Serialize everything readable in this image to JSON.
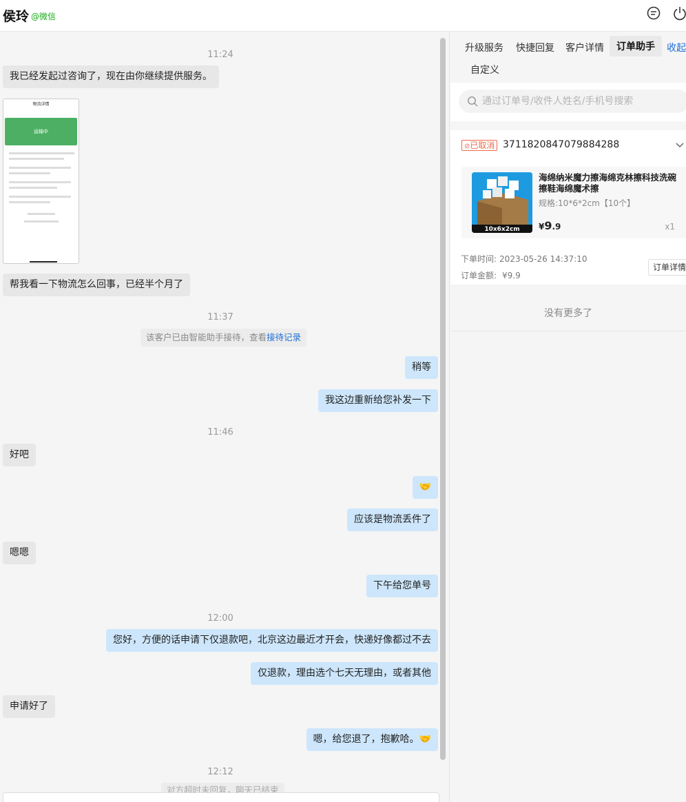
{
  "header": {
    "contact_name": "侯玲",
    "contact_source": "@微信",
    "icons": [
      "chat-bubble-icon",
      "power-icon"
    ]
  },
  "chat": {
    "messages": [
      {
        "type": "time",
        "text": "11:24"
      },
      {
        "type": "left",
        "text": "我已经发起过咨询了，现在由你继续提供服务。"
      },
      {
        "type": "image",
        "title": "物流详情",
        "status": "运输中"
      },
      {
        "type": "left",
        "text": "帮我看一下物流怎么回事，已经半个月了"
      },
      {
        "type": "time",
        "text": "11:37"
      },
      {
        "type": "system",
        "text": "该客户已由智能助手接待，查看",
        "link": "接待记录"
      },
      {
        "type": "right",
        "text": "稍等"
      },
      {
        "type": "right",
        "text": "我这边重新给您补发一下"
      },
      {
        "type": "time",
        "text": "11:46"
      },
      {
        "type": "left",
        "text": "好吧"
      },
      {
        "type": "right",
        "text": "🤝"
      },
      {
        "type": "right",
        "text": "应该是物流丢件了"
      },
      {
        "type": "left",
        "text": "嗯嗯"
      },
      {
        "type": "right",
        "text": "下午给您单号"
      },
      {
        "type": "time",
        "text": "12:00"
      },
      {
        "type": "right",
        "text": "您好，方便的话申请下仅退款吧，北京这边最近才开会，快递好像都过不去"
      },
      {
        "type": "right",
        "text": "仅退款，理由选个七天无理由，或者其他"
      },
      {
        "type": "left",
        "text": "申请好了"
      },
      {
        "type": "right",
        "text": "嗯，给您退了，抱歉哈。🤝"
      },
      {
        "type": "time",
        "text": "12:12"
      },
      {
        "type": "system",
        "text": "对方超时未回复，聊天已结束"
      }
    ]
  },
  "panel": {
    "tabs": [
      "升级服务",
      "快捷回复",
      "客户详情",
      "订单助手",
      "自定义"
    ],
    "active_tab": "订单助手",
    "collapse_label": "收起",
    "search_placeholder": "通过订单号/收件人姓名/手机号搜索",
    "order": {
      "status": "已取消",
      "order_no": "3711820847079884288",
      "goods_title": "海绵纳米魔力擦海绵克林擦科技洗碗擦鞋海绵魔术擦",
      "goods_spec": "规格:10*6*2cm【10个】",
      "price_symbol": "¥",
      "price_int": "9",
      "price_dec": ".9",
      "qty": "x1",
      "image_label": "10x6x2cm",
      "order_time_label": "下单时间:",
      "order_time": "2023-05-26 14:37:10",
      "amount_label": "订单金额:",
      "amount": "¥9.9",
      "detail_button": "订单详情"
    },
    "no_more": "没有更多了"
  },
  "colors": {
    "accent_blue": "#1f6fd6",
    "right_bubble": "#cde6fb",
    "left_bubble": "#e7e7e7",
    "cancel_red": "#ee6a4c",
    "wechat_green": "#1aad19"
  }
}
